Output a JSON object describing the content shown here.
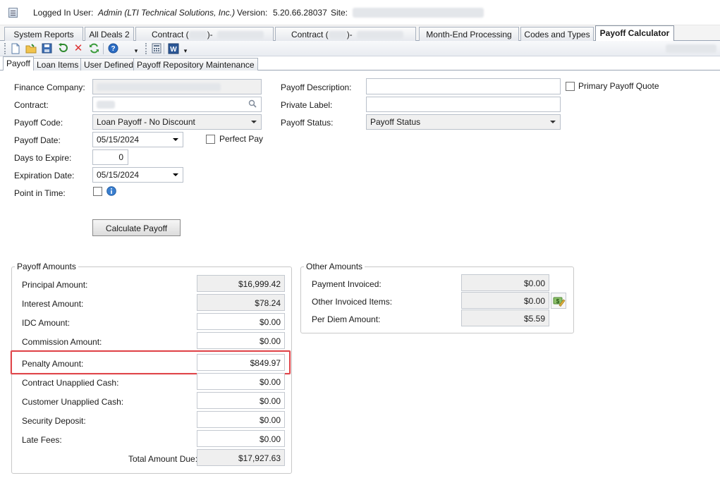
{
  "topbar": {
    "logged_in_label": "Logged In User:",
    "user": "Admin  (LTI Technical Solutions, Inc.)",
    "version_label": "Version:",
    "version": "5.20.66.28037",
    "site_label": "Site:"
  },
  "main_tabs": [
    {
      "label": "System Reports"
    },
    {
      "label": "All Deals 2"
    },
    {
      "label": "Contract ("
    },
    {
      "label": "Contract ("
    },
    {
      "label": "Month-End Processing"
    },
    {
      "label": "Codes and Types"
    },
    {
      "label": "Payoff Calculator"
    }
  ],
  "main_tabs_suffix": ")-",
  "sub_tabs": [
    {
      "label": "Payoff"
    },
    {
      "label": "Loan Items"
    },
    {
      "label": "User Defined"
    },
    {
      "label": "Payoff Repository Maintenance"
    }
  ],
  "form": {
    "finance_company_label": "Finance Company:",
    "contract_label": "Contract:",
    "payoff_code_label": "Payoff Code:",
    "payoff_code_value": "Loan Payoff - No Discount",
    "payoff_date_label": "Payoff Date:",
    "payoff_date_value": "05/15/2024",
    "perfect_pay_label": "Perfect Pay",
    "days_to_expire_label": "Days to Expire:",
    "days_to_expire_value": "0",
    "expiration_date_label": "Expiration Date:",
    "expiration_date_value": "05/15/2024",
    "point_in_time_label": "Point in Time:",
    "calculate_button": "Calculate Payoff",
    "payoff_description_label": "Payoff Description:",
    "primary_payoff_quote_label": "Primary Payoff Quote",
    "private_label_label": "Private Label:",
    "payoff_status_label": "Payoff Status:",
    "payoff_status_value": "Payoff Status"
  },
  "payoff_amounts": {
    "title": "Payoff Amounts",
    "rows": [
      {
        "label": "Principal Amount:",
        "value": "$16,999.42"
      },
      {
        "label": "Interest Amount:",
        "value": "$78.24"
      },
      {
        "label": "IDC Amount:",
        "value": "$0.00"
      },
      {
        "label": "Commission Amount:",
        "value": "$0.00"
      },
      {
        "label": "Penalty Amount:",
        "value": "$849.97"
      },
      {
        "label": "Contract Unapplied Cash:",
        "value": "$0.00"
      },
      {
        "label": "Customer Unapplied Cash:",
        "value": "$0.00"
      },
      {
        "label": "Security Deposit:",
        "value": "$0.00"
      },
      {
        "label": "Late Fees:",
        "value": "$0.00"
      }
    ],
    "total_label": "Total Amount Due:",
    "total_value": "$17,927.63"
  },
  "other_amounts": {
    "title": "Other Amounts",
    "rows": [
      {
        "label": "Payment Invoiced:",
        "value": "$0.00"
      },
      {
        "label": "Other Invoiced Items:",
        "value": "$0.00"
      },
      {
        "label": "Per Diem Amount:",
        "value": "$5.59"
      }
    ]
  },
  "colors": {
    "highlight": "#e0474c",
    "tab_border": "#a9b2bf",
    "readonly_fill": "#efefef"
  },
  "icons": [
    "app-grid-icon",
    "new-document-icon",
    "open-folder-icon",
    "save-icon",
    "undo-icon",
    "delete-icon",
    "refresh-icon",
    "help-icon",
    "overflow-icon",
    "calculator-icon",
    "word-export-icon",
    "search-icon",
    "info-icon",
    "money-edit-icon"
  ]
}
